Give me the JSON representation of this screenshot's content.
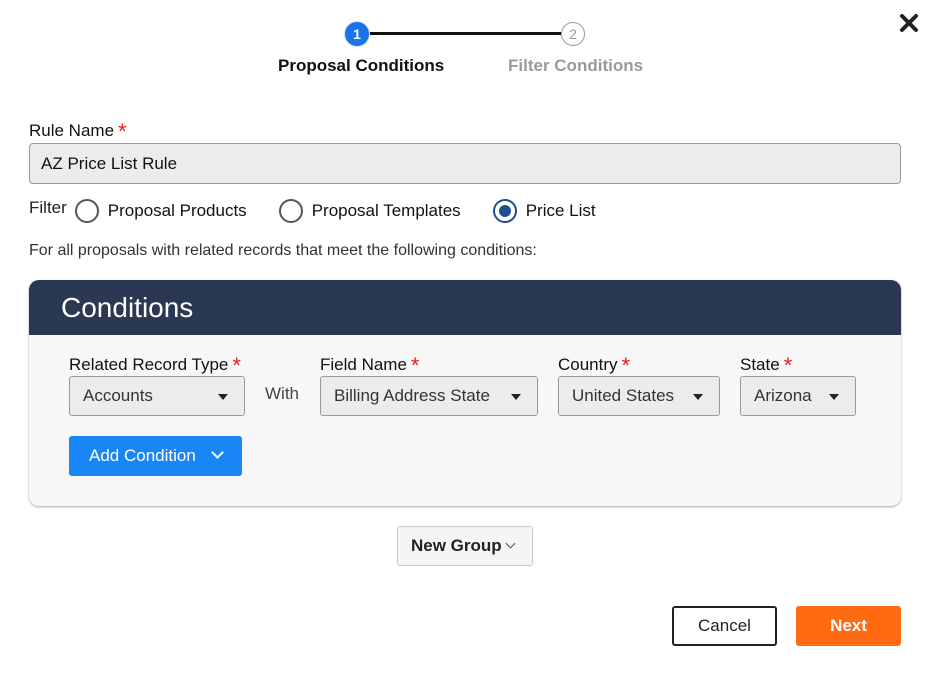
{
  "dialog": {
    "close_icon": "close-icon"
  },
  "stepper": {
    "steps": [
      {
        "number": "1",
        "label": "Proposal Conditions",
        "state": "active"
      },
      {
        "number": "2",
        "label": "Filter Conditions",
        "state": "inactive"
      }
    ]
  },
  "rule_name": {
    "label": "Rule Name",
    "required_mark": "*",
    "value": "AZ Price List Rule"
  },
  "filter": {
    "label": "Filter",
    "options": [
      {
        "label": "Proposal Products",
        "checked": false
      },
      {
        "label": "Proposal Templates",
        "checked": false
      },
      {
        "label": "Price List",
        "checked": true
      }
    ]
  },
  "instructions": "For all proposals with related records that meet the following conditions:",
  "conditions": {
    "title": "Conditions",
    "related_record_type": {
      "label": "Related Record Type",
      "value": "Accounts"
    },
    "with_text": "With",
    "field_name": {
      "label": "Field Name",
      "value": "Billing Address State"
    },
    "country": {
      "label": "Country",
      "value": "United States"
    },
    "state": {
      "label": "State",
      "value": "Arizona"
    },
    "required_mark": "*",
    "add_condition_label": "Add Condition"
  },
  "new_group_label": "New Group",
  "footer": {
    "cancel_label": "Cancel",
    "next_label": "Next"
  },
  "colors": {
    "primary_blue": "#1a86f5",
    "header_navy": "#2b3854",
    "next_orange": "#ff6a13",
    "required_red": "#e02020"
  }
}
